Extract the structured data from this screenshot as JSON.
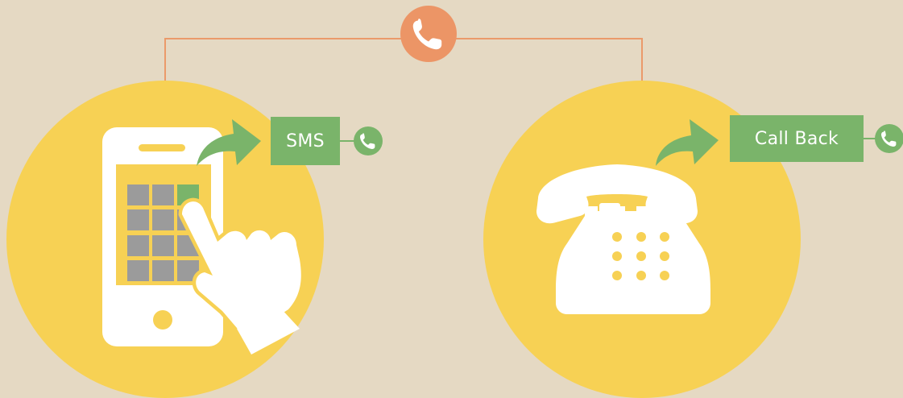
{
  "colors": {
    "background": "#e5d9c3",
    "circle": "#f7d154",
    "connector": "#eb9a6a",
    "phone_badge": "#ec9566",
    "label_box": "#7ab46a",
    "arrow": "#7ab46a",
    "device": "#ffffff",
    "keypad_key": "#9b9b9b",
    "keypad_key_active": "#7ab46a",
    "dial_dots": "#f7d154"
  },
  "icons": {
    "top": "phone-handset-icon",
    "left_device": "smartphone-tap-icon",
    "right_device": "desk-telephone-icon",
    "label_badge": "phone-handset-icon",
    "arrow": "curved-arrow-icon"
  },
  "labels": {
    "sms": "SMS",
    "call_back": "Call Back"
  }
}
